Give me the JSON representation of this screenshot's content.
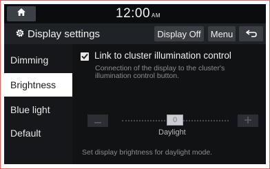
{
  "status": {
    "time": "12:00",
    "ampm": "AM"
  },
  "header": {
    "title": "Display settings",
    "display_off_label": "Display Off",
    "menu_label": "Menu"
  },
  "sidebar": {
    "items": [
      {
        "label": "Dimming"
      },
      {
        "label": "Brightness"
      },
      {
        "label": "Blue light"
      },
      {
        "label": "Default"
      }
    ]
  },
  "main": {
    "checkbox": {
      "label": "Link to cluster illumination control",
      "checked": true,
      "description": "Connection of the display to the cluster's illumination control button."
    },
    "slider": {
      "value": "0",
      "label": "Daylight"
    },
    "hint": "Set display brightness for daylight mode."
  },
  "icons": {
    "home": "home-icon",
    "settings": "gear-icon",
    "back": "back-arrow-icon",
    "minus": "minus-icon",
    "plus": "plus-icon",
    "check": "check-icon"
  },
  "colors": {
    "background": "#111214",
    "active_item": "#ffffff",
    "button": "#3a3d43",
    "frame_border": "#e0625e"
  }
}
